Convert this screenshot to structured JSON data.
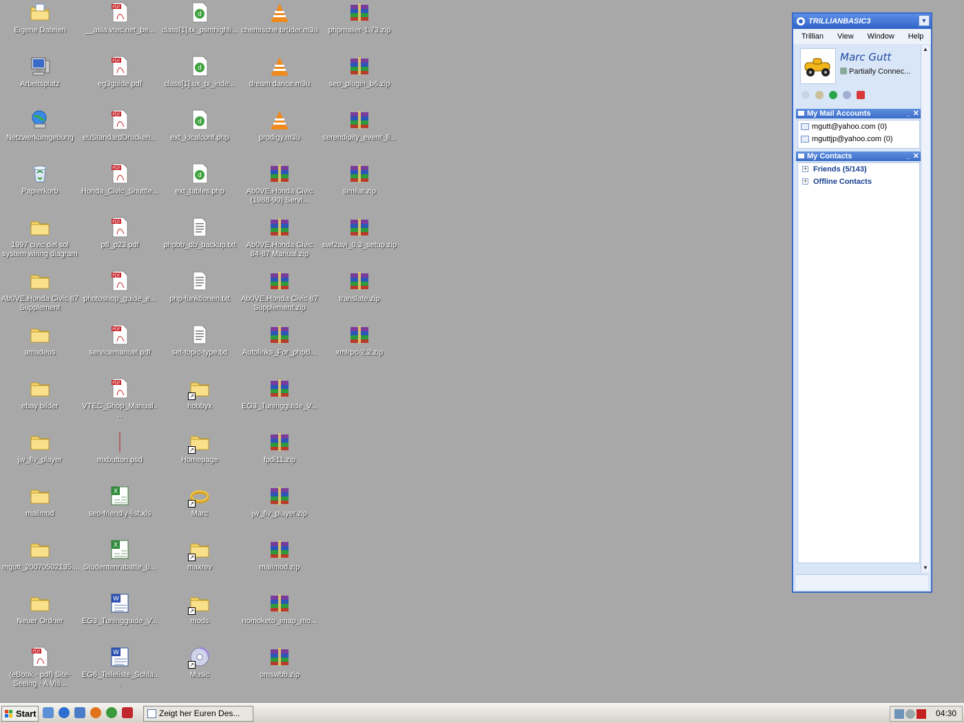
{
  "desktop": {
    "icons": [
      {
        "label": "Eigene Dateien",
        "type": "mydocs"
      },
      {
        "label": "Arbeitsplatz",
        "type": "computer"
      },
      {
        "label": "Netzwerkumgebung",
        "type": "network"
      },
      {
        "label": "Papierkorb",
        "type": "recycle"
      },
      {
        "label": "1997 civic del sol system wiring diagram",
        "type": "folder"
      },
      {
        "label": "Ab0VE.Honda Civic 87 Supplement",
        "type": "folder"
      },
      {
        "label": "amadeus",
        "type": "folder"
      },
      {
        "label": "ebay bilder",
        "type": "folder"
      },
      {
        "label": "jw_flv_player",
        "type": "folder"
      },
      {
        "label": "mailmod",
        "type": "folder"
      },
      {
        "label": "mgutt_20070502135...",
        "type": "folder"
      },
      {
        "label": "Neuer Ordner",
        "type": "folder"
      },
      {
        "label": "(eBook - pdf) Site-Seeing - A Vis...",
        "type": "pdf"
      },
      {
        "label": "__asia.vtec.net_be...",
        "type": "pdf"
      },
      {
        "label": "eg3guide.pdf",
        "type": "pdf"
      },
      {
        "label": "euStandardDrucken...",
        "type": "pdf"
      },
      {
        "label": "Honda_Civic_Shuttle...",
        "type": "pdf"
      },
      {
        "label": "p8_p23.pdf",
        "type": "pdf"
      },
      {
        "label": "photoshop_guide_e...",
        "type": "pdf"
      },
      {
        "label": "servicemanuel.pdf",
        "type": "pdf"
      },
      {
        "label": "VTEC_Shop_Manual....",
        "type": "pdf"
      },
      {
        "label": "mxbutton.psd",
        "type": "psd"
      },
      {
        "label": "seo-friendly-list.xls",
        "type": "xls"
      },
      {
        "label": "Studentenrabatte_ü...",
        "type": "xls"
      },
      {
        "label": "EG3_Tuningguide_V...",
        "type": "doc"
      },
      {
        "label": "EG6_Teileliste_Schla...",
        "type": "doc"
      },
      {
        "label": "class[1].tx_psmhighli...",
        "type": "php"
      },
      {
        "label": "class[1].ux_tx_inde...",
        "type": "php"
      },
      {
        "label": "ext_localconf.php",
        "type": "php"
      },
      {
        "label": "ext_tables.php",
        "type": "php"
      },
      {
        "label": "phpbb_db_backup.txt",
        "type": "txt"
      },
      {
        "label": "php-funktionen.txt",
        "type": "txt"
      },
      {
        "label": "set-topic-type.txt",
        "type": "txt"
      },
      {
        "label": "hobbyx",
        "type": "folder-link"
      },
      {
        "label": "Homepage",
        "type": "folder-link"
      },
      {
        "label": "Marc",
        "type": "ring-link"
      },
      {
        "label": "maxrev",
        "type": "folder-link"
      },
      {
        "label": "mods",
        "type": "folder-link"
      },
      {
        "label": "Music",
        "type": "cd-link"
      },
      {
        "label": "chemische brüder.m3u",
        "type": "vlc"
      },
      {
        "label": "dream dance.m3u",
        "type": "vlc"
      },
      {
        "label": "prodigy.m3u",
        "type": "vlc"
      },
      {
        "label": "Ab0VE.Honda Civic (1988-90) Servi...",
        "type": "zip"
      },
      {
        "label": "Ab0VE.Honda Civic 84-87 Manual.zip",
        "type": "zip"
      },
      {
        "label": "Ab0VE.Honda Civic 87 Supplement.zip",
        "type": "zip"
      },
      {
        "label": "Autolinks_For_phpB...",
        "type": "zip"
      },
      {
        "label": "EG3_Tuningguide_V...",
        "type": "zip"
      },
      {
        "label": "fpdi11.zip",
        "type": "zip"
      },
      {
        "label": "jw_flv_player.zip",
        "type": "zip"
      },
      {
        "label": "mailmod.zip",
        "type": "zip"
      },
      {
        "label": "nomoketo_imap_mo...",
        "type": "zip"
      },
      {
        "label": "omswbb.zip",
        "type": "zip"
      },
      {
        "label": "phpmailer-1.73.zip",
        "type": "zip"
      },
      {
        "label": "seo_plugin_b6.zip",
        "type": "zip"
      },
      {
        "label": "serendipity_event_fi...",
        "type": "zip"
      },
      {
        "label": "similar.zip",
        "type": "zip"
      },
      {
        "label": "swf2avi_0.3_setup.zip",
        "type": "zip"
      },
      {
        "label": "translate.zip",
        "type": "zip"
      },
      {
        "label": "xmlrpc-2.2.zip",
        "type": "zip"
      }
    ]
  },
  "trillian": {
    "title": "TRILLIANBASIC3",
    "menu": [
      "Trillian",
      "View",
      "Window",
      "Help"
    ],
    "profile_name": "Marc Gutt",
    "profile_status": "Partially Connec...",
    "mail_section_title": "My Mail Accounts",
    "mail_accounts": [
      "mgutt@yahoo.com (0)",
      "mguttjp@yahoo.com (0)"
    ],
    "contacts_section_title": "My Contacts",
    "contact_groups": [
      "Friends (5/143)",
      "Offline Contacts"
    ],
    "minimize_glyph": "_",
    "close_glyph": "✕",
    "expand_glyph": "+"
  },
  "taskbar": {
    "start_label": "Start",
    "task_label": "Zeigt her Euren Des...",
    "clock": "04:30"
  },
  "colors": {
    "desktop_bg": "#a8a8a8",
    "trillian_accent": "#3a6ac8"
  }
}
